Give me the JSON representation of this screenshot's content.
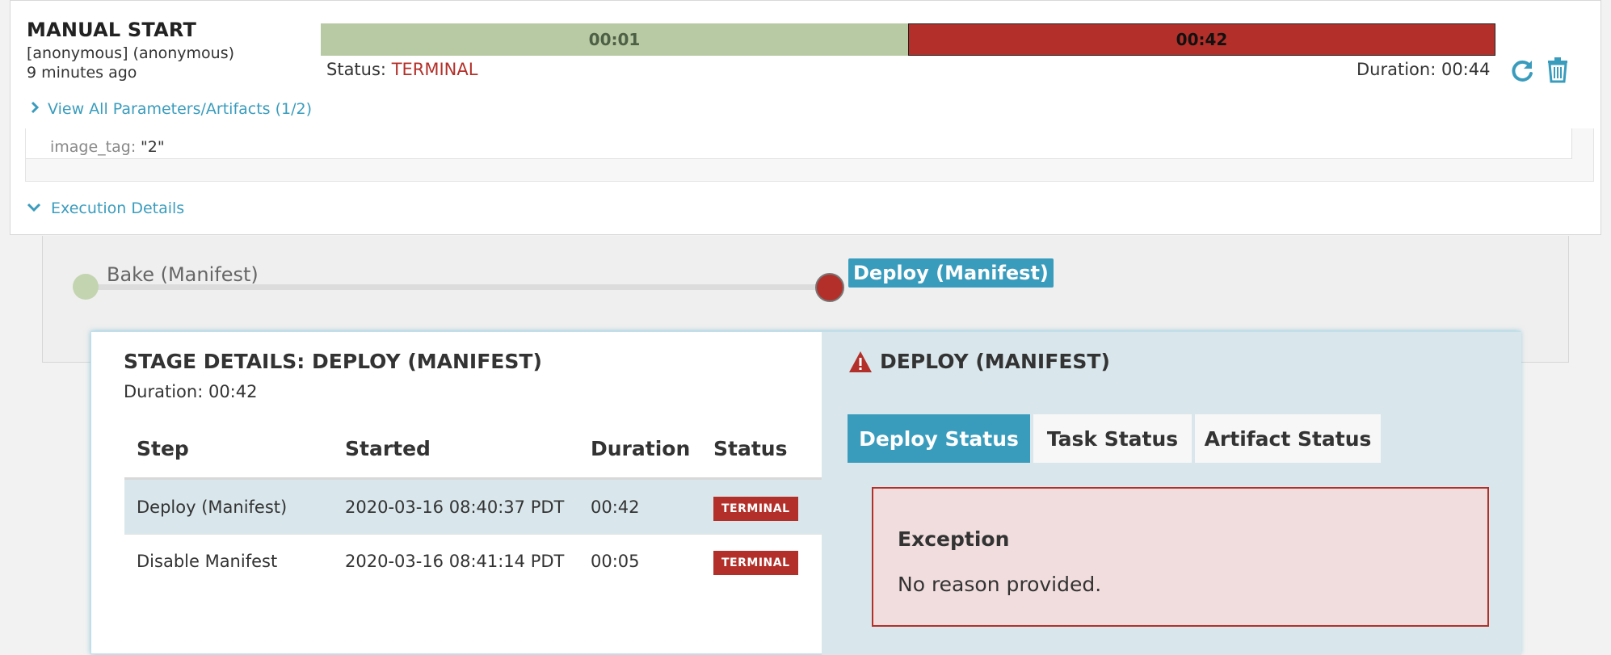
{
  "execution": {
    "trigger": "MANUAL START",
    "user": "[anonymous] (anonymous)",
    "time_ago": "9 minutes ago",
    "bar_segments": [
      {
        "label": "00:01",
        "fraction": 0.5,
        "color": "#b8caa3"
      },
      {
        "label": "00:42",
        "fraction": 0.5,
        "color": "#b3302a"
      }
    ],
    "status_label": "Status:",
    "status_value": "TERMINAL",
    "duration_text": "Duration: 00:44",
    "params_link": "View All Parameters/Artifacts (1/2)",
    "param_key": "image_tag:",
    "param_value": "\"2\"",
    "details_link": "Execution Details"
  },
  "pipeline": {
    "stages": [
      {
        "name": "Bake (Manifest)",
        "status": "succeeded"
      },
      {
        "name": "Deploy (Manifest)",
        "status": "terminal",
        "selected": true
      }
    ]
  },
  "stage_details": {
    "title": "STAGE DETAILS: DEPLOY (MANIFEST)",
    "duration": "Duration: 00:42",
    "columns": [
      "Step",
      "Started",
      "Duration",
      "Status"
    ],
    "rows": [
      {
        "step": "Deploy (Manifest)",
        "started": "2020-03-16 08:40:37 PDT",
        "duration": "00:42",
        "status": "TERMINAL"
      },
      {
        "step": "Disable Manifest",
        "started": "2020-03-16 08:41:14 PDT",
        "duration": "00:05",
        "status": "TERMINAL"
      }
    ]
  },
  "step_panel": {
    "heading": "DEPLOY (MANIFEST)",
    "tabs": [
      "Deploy Status",
      "Task Status",
      "Artifact Status"
    ],
    "active_tab": "Deploy Status",
    "exception_title": "Exception",
    "exception_message": "No reason provided."
  },
  "colors": {
    "accent": "#3a9cbd",
    "terminal": "#b3302a",
    "succeeded": "#b8caa3"
  }
}
